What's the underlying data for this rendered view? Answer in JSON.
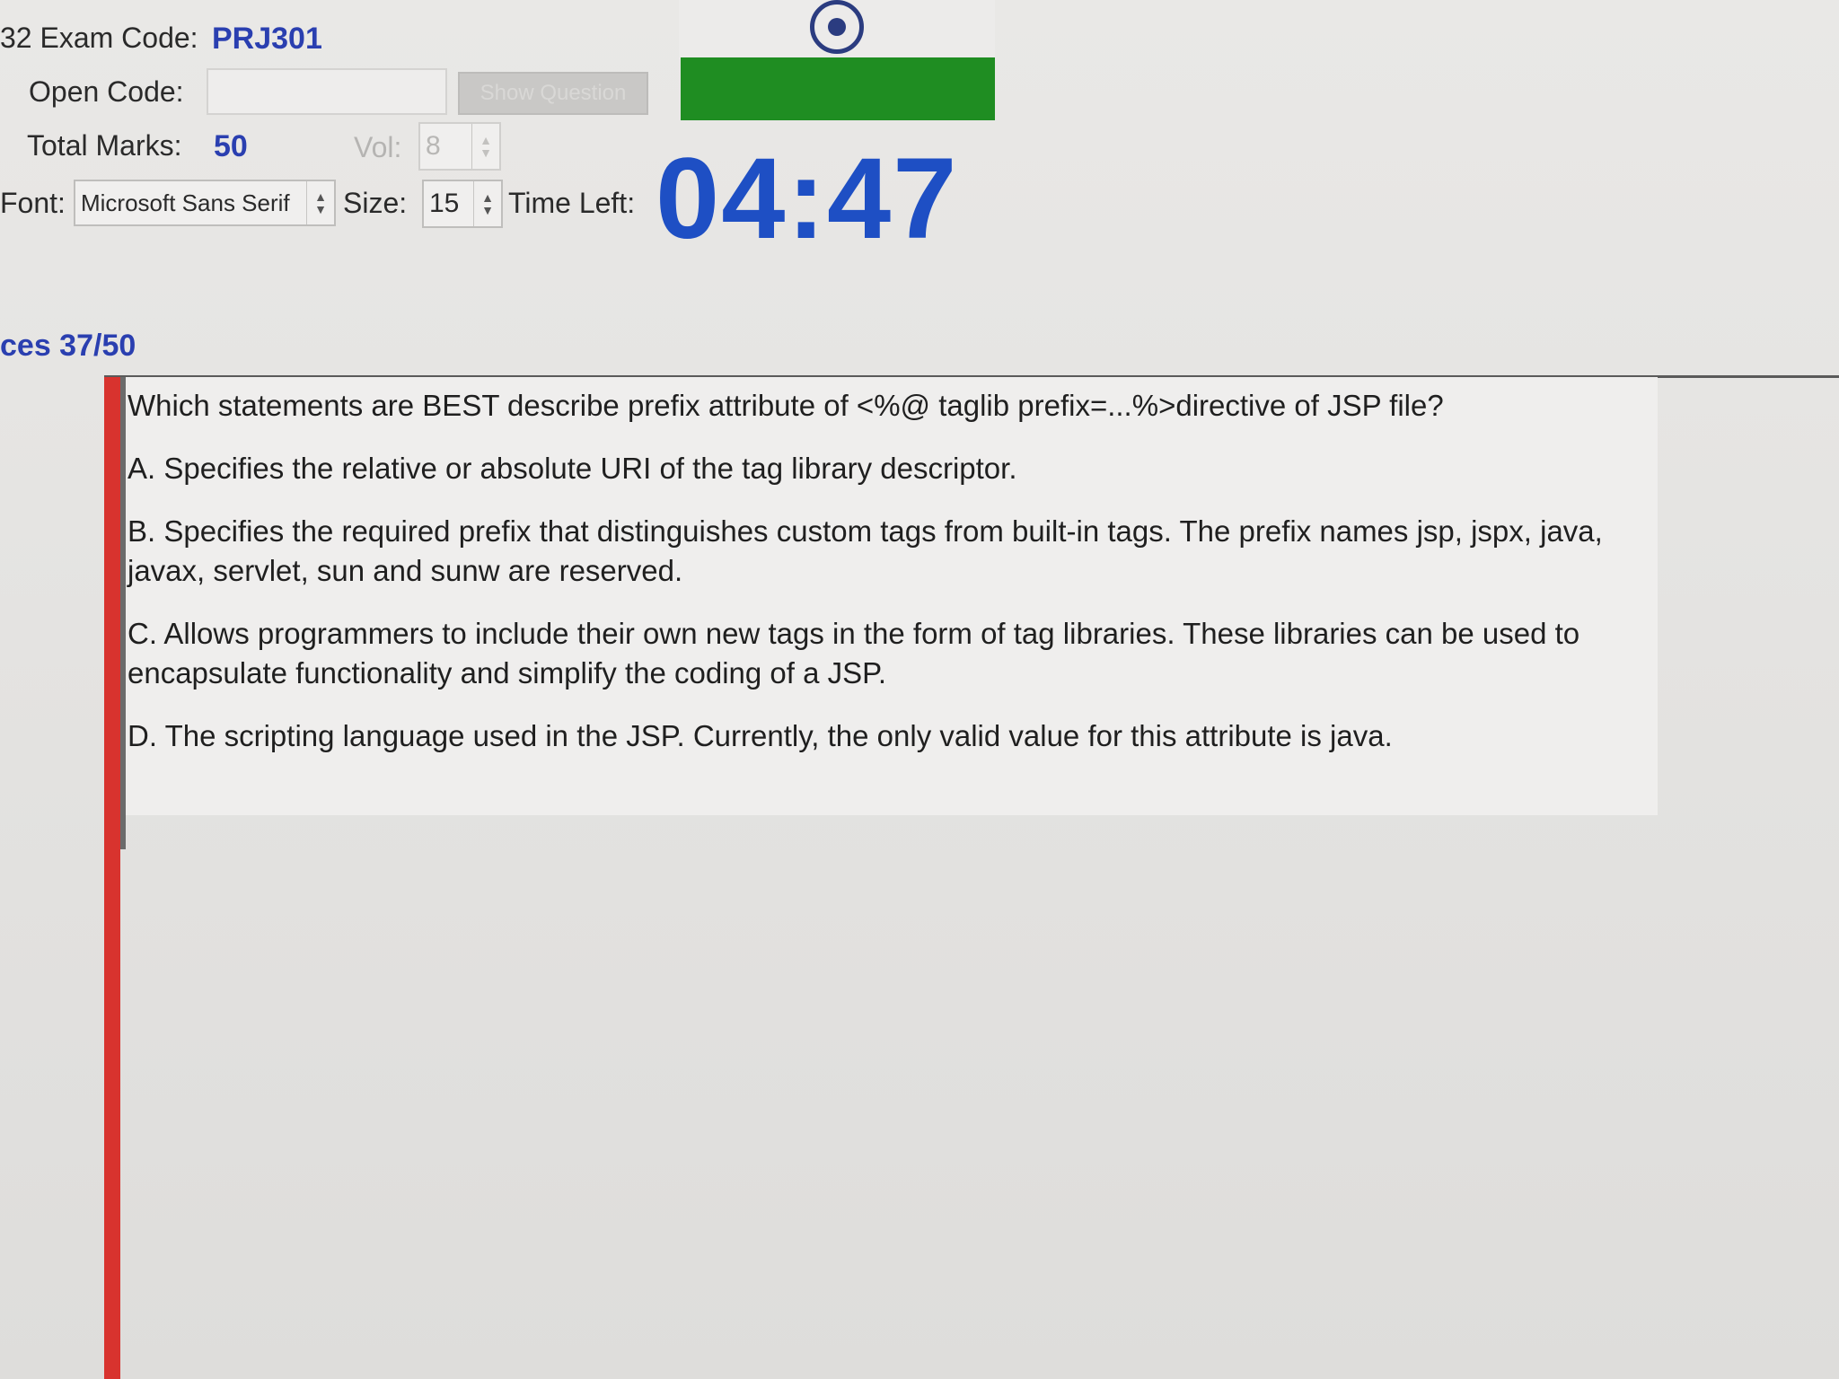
{
  "header": {
    "exam_code_label": "32 Exam Code:",
    "exam_code_value": "PRJ301",
    "open_code_label": "Open Code:",
    "open_code_value": "",
    "show_question_button": "Show Question",
    "total_marks_label": "Total Marks:",
    "total_marks_value": "50",
    "vol_label": "Vol:",
    "vol_value": "8",
    "font_label": "Font:",
    "font_value": "Microsoft Sans Serif",
    "size_label": "Size:",
    "size_value": "15",
    "time_left_label": "Time Left:",
    "time_left_value": "04:47"
  },
  "progress": {
    "text": "ces 37/50"
  },
  "question": {
    "stem": "Which statements are BEST describe prefix attribute of <%@ taglib prefix=...%>directive of JSP file?",
    "options": [
      "A. Specifies the relative or absolute URI of the tag library descriptor.",
      "B. Specifies the required prefix that distinguishes custom tags from built-in tags. The prefix names jsp, jspx, java, javax, servlet, sun and sunw are reserved.",
      "C. Allows programmers to include their own new tags in the form of tag libraries. These libraries can be used to encapsulate functionality and simplify the coding of a JSP.",
      "D. The scripting language used in the JSP. Currently, the only valid value for this attribute is java."
    ]
  },
  "colors": {
    "timer": "#1e4fc4",
    "value_blue": "#2a3fb0",
    "flag_green": "#1f8d22",
    "accent_red": "#d8332e"
  },
  "icons": {
    "flag_emblem": "ashoka-chakra-icon",
    "spin_up": "chevron-up-icon",
    "spin_down": "chevron-down-icon"
  }
}
